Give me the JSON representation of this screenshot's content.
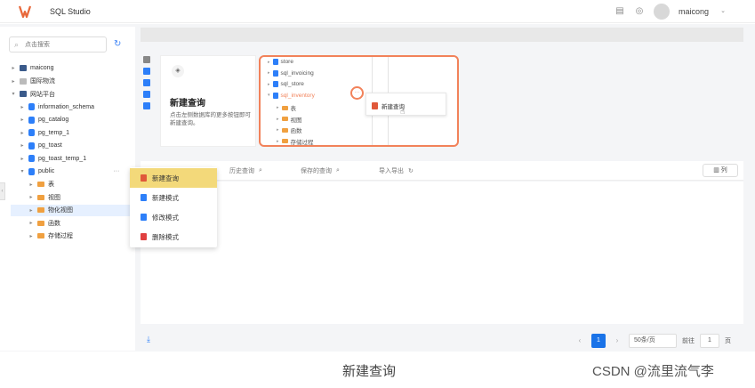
{
  "header": {
    "app_title": "SQL Studio",
    "user_name": "maicong",
    "icons": [
      "logo-icon",
      "notes-icon",
      "settings-icon",
      "avatar",
      "chevron-down-icon"
    ]
  },
  "sidebar": {
    "search_placeholder": "点击搜索",
    "tree": [
      {
        "label": "maicong",
        "icon": "server-icon",
        "level": 0,
        "expanded": false
      },
      {
        "label": "国际物流",
        "icon": "server-icon-grey",
        "level": 0,
        "expanded": false
      },
      {
        "label": "网站平台",
        "icon": "server-icon",
        "level": 0,
        "expanded": true
      },
      {
        "label": "information_schema",
        "icon": "database-icon",
        "level": 1
      },
      {
        "label": "pg_catalog",
        "icon": "database-icon",
        "level": 1
      },
      {
        "label": "pg_temp_1",
        "icon": "database-icon",
        "level": 1
      },
      {
        "label": "pg_toast",
        "icon": "database-icon",
        "level": 1
      },
      {
        "label": "pg_toast_temp_1",
        "icon": "database-icon",
        "level": 1
      },
      {
        "label": "public",
        "icon": "database-icon",
        "level": 1,
        "expanded": true,
        "more": "···"
      },
      {
        "label": "表",
        "icon": "folder-icon",
        "level": 2
      },
      {
        "label": "视图",
        "icon": "folder-icon",
        "level": 2
      },
      {
        "label": "物化视图",
        "icon": "folder-icon",
        "level": 2,
        "selected": true
      },
      {
        "label": "函数",
        "icon": "folder-icon",
        "level": 2
      },
      {
        "label": "存储过程",
        "icon": "folder-icon",
        "level": 2
      }
    ]
  },
  "empty_state": {
    "title": "新建查询",
    "description": "点击左侧数据库的更多按钮即可新建查询。"
  },
  "illustration": {
    "tree": [
      {
        "label": "store"
      },
      {
        "label": "sql_invoicing"
      },
      {
        "label": "sql_store"
      },
      {
        "label": "sql_inventory",
        "highlight": true
      },
      {
        "label": "表",
        "folder": true
      },
      {
        "label": "视图",
        "folder": true
      },
      {
        "label": "函数",
        "folder": true
      },
      {
        "label": "存储过程",
        "folder": true
      }
    ],
    "popup_item": "新建查询",
    "more_dots": "···"
  },
  "tabs": [
    {
      "label": "历史查询",
      "icon": "search-icon"
    },
    {
      "label": "保存的查询",
      "icon": "search-icon"
    },
    {
      "label": "导入导出",
      "icon": "refresh-icon"
    }
  ],
  "column_button": "列",
  "context_menu": [
    {
      "label": "新建查询",
      "active": true,
      "color": "#e0583a"
    },
    {
      "label": "新建模式",
      "color": "#2d7ff9"
    },
    {
      "label": "修改模式",
      "color": "#2d7ff9"
    },
    {
      "label": "删除模式",
      "color": "#e04040"
    }
  ],
  "pagination": {
    "current_page": "1",
    "page_size": "50条/页",
    "goto_label": "前往",
    "goto_value": "1",
    "page_unit": "页"
  },
  "caption": "新建查询",
  "watermark": "CSDN @流里流气李",
  "colors": {
    "accent": "#1a73e8",
    "highlight_border": "#f2825a",
    "menu_active": "#f3d97a"
  }
}
